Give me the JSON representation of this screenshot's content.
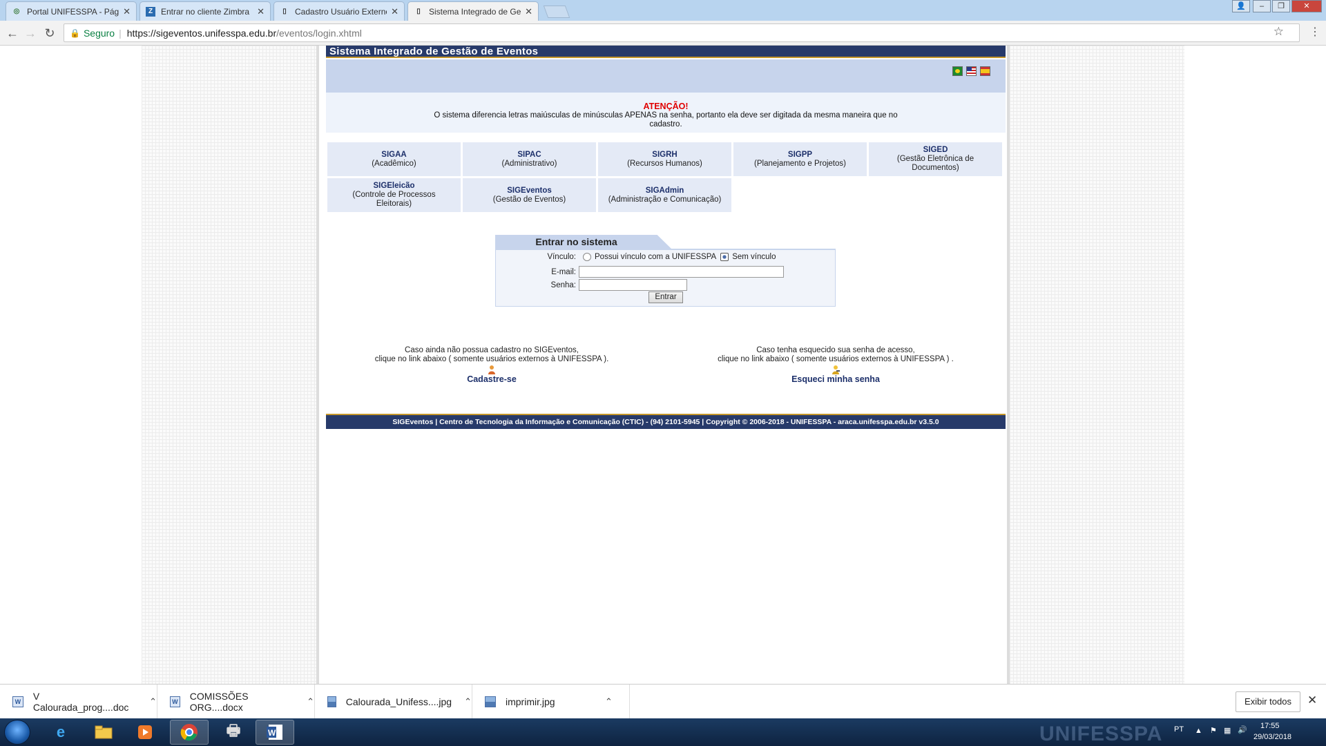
{
  "browser": {
    "tabs": [
      {
        "label": "Portal UNIFESSPA - Págin",
        "favicon": "globe-icon"
      },
      {
        "label": "Entrar no cliente Zimbra",
        "favicon": "zimbra-icon"
      },
      {
        "label": "Cadastro Usuário Externo",
        "favicon": "page-icon"
      },
      {
        "label": "Sistema Integrado de Ge",
        "favicon": "page-icon",
        "active": true
      }
    ],
    "security_label": "Seguro",
    "url_host": "https://sigeventos.unifesspa.edu.br",
    "url_path": "/eventos/login.xhtml"
  },
  "page": {
    "header_title": "Sistema Integrado de Gestão de Eventos",
    "notice": {
      "title": "ATENÇÃO!",
      "text": "O sistema diferencia letras maiúsculas de minúsculas APENAS na senha, portanto ela deve ser digitada da mesma maneira que no cadastro."
    },
    "systems": [
      {
        "name": "SIGAA",
        "desc": "(Acadêmico)"
      },
      {
        "name": "SIPAC",
        "desc": "(Administrativo)"
      },
      {
        "name": "SIGRH",
        "desc": "(Recursos Humanos)"
      },
      {
        "name": "SIGPP",
        "desc": "(Planejamento e Projetos)"
      },
      {
        "name": "SIGED",
        "desc": "(Gestão Eletrônica de Documentos)"
      },
      {
        "name": "SIGEleicão",
        "desc": "(Controle de Processos Eleitorais)"
      },
      {
        "name": "SIGEventos",
        "desc": "(Gestão de Eventos)"
      },
      {
        "name": "SIGAdmin",
        "desc": "(Administração e Comunicação)"
      }
    ],
    "login": {
      "title": "Entrar no sistema",
      "vinculo_label": "Vínculo:",
      "option_with": "Possui vínculo com a UNIFESSPA",
      "option_without": "Sem vínculo",
      "selected_option": "Sem vínculo",
      "email_label": "E-mail:",
      "email_value": "",
      "password_label": "Senha:",
      "password_value": "",
      "submit_label": "Entrar"
    },
    "register": {
      "line1": "Caso ainda não possua cadastro no SIGEventos,",
      "line2": "clique no link abaixo ( somente usuários externos à UNIFESSPA ).",
      "link": "Cadastre-se"
    },
    "forgot": {
      "line1": "Caso tenha esquecido sua senha de acesso,",
      "line2": "clique no link abaixo ( somente usuários externos à UNIFESSPA ) .",
      "link": "Esqueci minha senha"
    },
    "footer": "SIGEventos | Centro de Tecnologia da Informação e Comunicação (CTIC) - (94) 2101-5945 | Copyright © 2006-2018 - UNIFESSPA - araca.unifesspa.edu.br v3.5.0"
  },
  "downloads": {
    "items": [
      {
        "name": "V Calourada_prog....doc",
        "icon": "word-doc-icon"
      },
      {
        "name": "COMISSÕES ORG....docx",
        "icon": "word-doc-icon"
      },
      {
        "name": "Calourada_Unifess....jpg",
        "icon": "image-file-icon"
      },
      {
        "name": "imprimir.jpg",
        "icon": "image-file-icon"
      }
    ],
    "show_all_label": "Exibir todos"
  },
  "taskbar": {
    "language": "PT",
    "time": "17:55",
    "date": "29/03/2018",
    "watermark": "UNIFESSPA"
  },
  "colors": {
    "header_navy": "#273a6a",
    "accent_gold": "#c5962a",
    "band_blue": "#c7d4ec",
    "alert_red": "#e00000"
  }
}
